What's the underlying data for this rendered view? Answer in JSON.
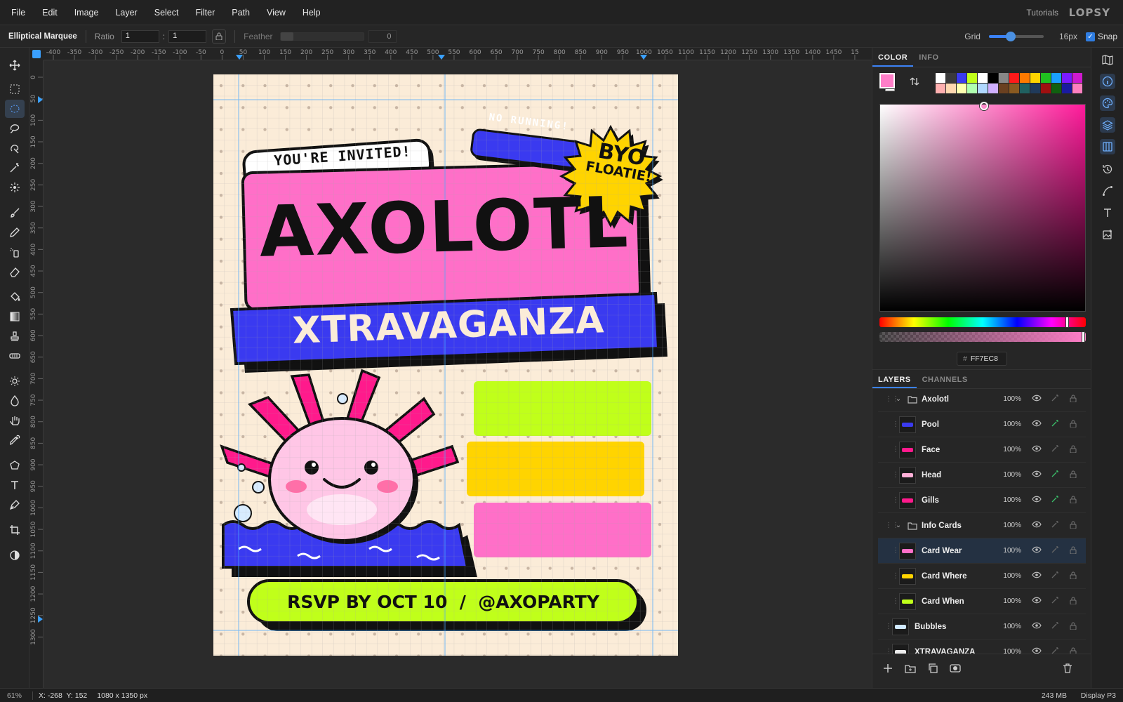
{
  "menu": [
    "File",
    "Edit",
    "Image",
    "Layer",
    "Select",
    "Filter",
    "Path",
    "View",
    "Help"
  ],
  "header": {
    "tutorials": "Tutorials",
    "logo": "LOPSY"
  },
  "options": {
    "tool_name": "Elliptical Marquee",
    "ratio_label": "Ratio",
    "ratio_w": "1",
    "ratio_sep": ":",
    "ratio_h": "1",
    "feather_label": "Feather",
    "feather_value": "0",
    "grid_label": "Grid",
    "grid_size": "16px",
    "snap_label": "Snap",
    "snap_checked": true
  },
  "tools": [
    "move-icon",
    "rect-marquee-icon",
    "ellipse-marquee-icon",
    "lasso-icon",
    "quick-select-icon",
    "magic-wand-icon",
    "object-select-icon",
    "brush-icon",
    "pencil-icon",
    "spray-icon",
    "eraser-icon",
    "bucket-icon",
    "gradient-icon",
    "stamp-icon",
    "heal-icon",
    "dodge-icon",
    "burn-icon",
    "hand-icon",
    "eyedropper-icon",
    "shape-icon",
    "text-icon",
    "pen-icon",
    "crop-icon",
    "contrast-icon"
  ],
  "rulers": {
    "top_ticks": [
      "-400",
      "-350",
      "-300",
      "-250",
      "-200",
      "-150",
      "-100",
      "-50",
      "0",
      "50",
      "100",
      "150",
      "200",
      "250",
      "300",
      "350",
      "400",
      "450",
      "500",
      "550",
      "600",
      "650",
      "700",
      "750",
      "800",
      "850",
      "900",
      "950",
      "1000",
      "1050",
      "1100",
      "1150",
      "1200",
      "1250",
      "1300",
      "1350",
      "1400",
      "1450",
      "15"
    ],
    "left_ticks": [
      "0",
      "50",
      "100",
      "150",
      "200",
      "250",
      "300",
      "350",
      "400",
      "450",
      "500",
      "550",
      "600",
      "650",
      "700",
      "750",
      "800",
      "850",
      "900",
      "950",
      "1000",
      "1050",
      "1100",
      "1150",
      "1200",
      "1250",
      "1300"
    ]
  },
  "poster": {
    "invited": "YOU'RE INVITED!",
    "no_running": "NO RUNNING!",
    "byo_line1": "BYO",
    "byo_line2": "FLOATIE!",
    "title": "AXOLOTL",
    "subtitle": "XTRAVAGANZA",
    "rsvp": "RSVP BY OCT 10  /  @AXOPARTY",
    "colors": {
      "pink": "#ff6fc8",
      "blue": "#3a3af0",
      "lime": "#c0ff1a",
      "yellow": "#ffd400",
      "cream": "#fbecd8",
      "magenta": "#ff1a8c"
    }
  },
  "color_panel": {
    "tabs": [
      "COLOR",
      "INFO"
    ],
    "hex_prefix": "#",
    "hex": "FF7EC8",
    "fg_color": "#ff7ec8",
    "bg_color": "#ffffff",
    "swatches_row1": [
      "#ffffff",
      "#3a3a3a",
      "#3a3af0",
      "#c0ff1a",
      "#ffffff",
      "#000000",
      "#888888",
      "#ff1a1a",
      "#ff7a00",
      "#ffd400",
      "#20c020",
      "#1aa0ff",
      "#7a1aff",
      "#d01ad0"
    ],
    "swatches_row2": [
      "#ffb0b0",
      "#ffd8b0",
      "#ffffb0",
      "#b0ffb0",
      "#b0d8ff",
      "#d0b0ff",
      "#6a4020",
      "#8a5a20",
      "#206060",
      "#203a5a",
      "#a01010",
      "#106010",
      "#1a1aa0",
      "#ff80c0"
    ]
  },
  "layers_panel": {
    "tabs": [
      "LAYERS",
      "CHANNELS"
    ],
    "layers": [
      {
        "name": "Axolotl",
        "opacity": "100%",
        "type": "group",
        "indent": 1,
        "selected": false,
        "fx": false
      },
      {
        "name": "Pool",
        "opacity": "100%",
        "type": "layer",
        "indent": 2,
        "selected": false,
        "fx": true,
        "thumb": "#3a3af0"
      },
      {
        "name": "Face",
        "opacity": "100%",
        "type": "layer",
        "indent": 2,
        "selected": false,
        "fx": false,
        "thumb": "#ff1a8c"
      },
      {
        "name": "Head",
        "opacity": "100%",
        "type": "layer",
        "indent": 2,
        "selected": false,
        "fx": true,
        "thumb": "#ffb0d8"
      },
      {
        "name": "Gills",
        "opacity": "100%",
        "type": "layer",
        "indent": 2,
        "selected": false,
        "fx": true,
        "thumb": "#ff1a8c"
      },
      {
        "name": "Info Cards",
        "opacity": "100%",
        "type": "group",
        "indent": 1,
        "selected": false,
        "fx": false
      },
      {
        "name": "Card Wear",
        "opacity": "100%",
        "type": "layer",
        "indent": 2,
        "selected": true,
        "fx": false,
        "thumb": "#ff6fc8"
      },
      {
        "name": "Card Where",
        "opacity": "100%",
        "type": "layer",
        "indent": 2,
        "selected": false,
        "fx": false,
        "thumb": "#ffd400"
      },
      {
        "name": "Card When",
        "opacity": "100%",
        "type": "layer",
        "indent": 2,
        "selected": false,
        "fx": false,
        "thumb": "#c0ff1a"
      },
      {
        "name": "Bubbles",
        "opacity": "100%",
        "type": "layer",
        "indent": 1,
        "selected": false,
        "fx": false,
        "thumb": "#cfe8ff"
      },
      {
        "name": "XTRAVAGANZA",
        "opacity": "100%",
        "type": "layer",
        "indent": 1,
        "selected": false,
        "fx": false,
        "thumb": "#eeeeee"
      }
    ]
  },
  "status": {
    "zoom": "61%",
    "coords": "X: -268  Y: 152",
    "doc_size": "1080 x 1350 px",
    "memory": "243 MB",
    "color_profile": "Display P3"
  }
}
